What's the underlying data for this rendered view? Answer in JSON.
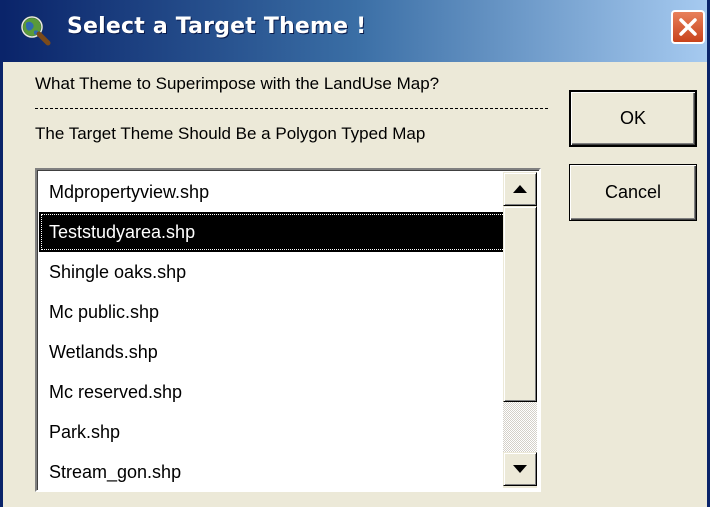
{
  "window": {
    "title": "Select a Target Theme !"
  },
  "prompt": {
    "line1": "What Theme to Superimpose with the LandUse Map?",
    "line2": "The Target Theme Should Be a Polygon Typed Map"
  },
  "buttons": {
    "ok": "OK",
    "cancel": "Cancel"
  },
  "list": {
    "items": [
      "Mdpropertyview.shp",
      "Teststudyarea.shp",
      "Shingle oaks.shp",
      "Mc public.shp",
      "Wetlands.shp",
      "Mc reserved.shp",
      "Park.shp",
      "Stream_gon.shp"
    ],
    "selected_item": "Teststudyarea.shp"
  },
  "colors": {
    "titlebar_dark": "#0a246a",
    "titlebar_light": "#a6caf0",
    "close_button": "#c8431c",
    "dialog_face": "#ece9d8",
    "selection": "#000000"
  },
  "icons": {
    "title": "globe-magnifier-icon",
    "close": "close-icon",
    "scroll_up": "arrow-up-icon",
    "scroll_down": "arrow-down-icon"
  }
}
